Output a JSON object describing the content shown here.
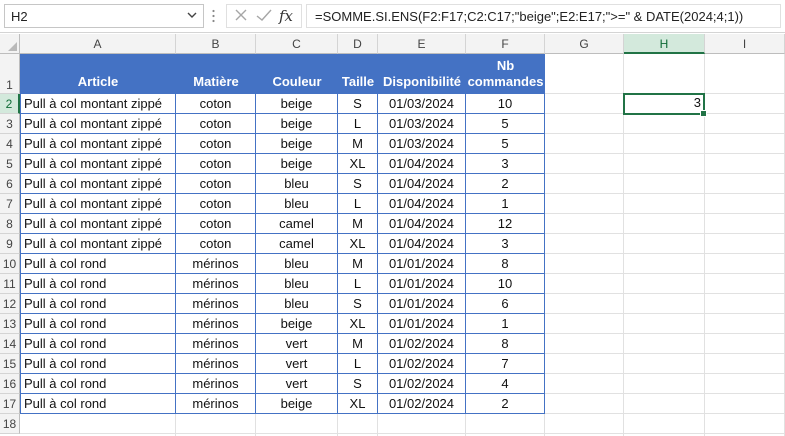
{
  "formula_bar": {
    "name_box": "H2",
    "formula": "=SOMME.SI.ENS(F2:F17;C2:C17;\"beige\";E2:E17;\">=\" & DATE(2024;4;1))",
    "fx_label": "fx"
  },
  "columns": [
    "A",
    "B",
    "C",
    "D",
    "E",
    "F",
    "G",
    "H",
    "I"
  ],
  "rows": [
    "1",
    "2",
    "3",
    "4",
    "5",
    "6",
    "7",
    "8",
    "9",
    "10",
    "11",
    "12",
    "13",
    "14",
    "15",
    "16",
    "17",
    "18"
  ],
  "headers": {
    "article": "Article",
    "matiere": "Matière",
    "couleur": "Couleur",
    "taille": "Taille",
    "disponibilite": "Disponibilité",
    "nb_commandes": "Nb commandes"
  },
  "data_rows": [
    {
      "article": "Pull à col montant zippé",
      "matiere": "coton",
      "couleur": "beige",
      "taille": "S",
      "dispo": "01/03/2024",
      "nb": "10"
    },
    {
      "article": "Pull à col montant zippé",
      "matiere": "coton",
      "couleur": "beige",
      "taille": "L",
      "dispo": "01/03/2024",
      "nb": "5"
    },
    {
      "article": "Pull à col montant zippé",
      "matiere": "coton",
      "couleur": "beige",
      "taille": "M",
      "dispo": "01/03/2024",
      "nb": "5"
    },
    {
      "article": "Pull à col montant zippé",
      "matiere": "coton",
      "couleur": "beige",
      "taille": "XL",
      "dispo": "01/04/2024",
      "nb": "3"
    },
    {
      "article": "Pull à col montant zippé",
      "matiere": "coton",
      "couleur": "bleu",
      "taille": "S",
      "dispo": "01/04/2024",
      "nb": "2"
    },
    {
      "article": "Pull à col montant zippé",
      "matiere": "coton",
      "couleur": "bleu",
      "taille": "L",
      "dispo": "01/04/2024",
      "nb": "1"
    },
    {
      "article": "Pull à col montant zippé",
      "matiere": "coton",
      "couleur": "camel",
      "taille": "M",
      "dispo": "01/04/2024",
      "nb": "12"
    },
    {
      "article": "Pull à col montant zippé",
      "matiere": "coton",
      "couleur": "camel",
      "taille": "XL",
      "dispo": "01/04/2024",
      "nb": "3"
    },
    {
      "article": "Pull à col rond",
      "matiere": "mérinos",
      "couleur": "bleu",
      "taille": "M",
      "dispo": "01/01/2024",
      "nb": "8"
    },
    {
      "article": "Pull à col rond",
      "matiere": "mérinos",
      "couleur": "bleu",
      "taille": "L",
      "dispo": "01/01/2024",
      "nb": "10"
    },
    {
      "article": "Pull à col rond",
      "matiere": "mérinos",
      "couleur": "bleu",
      "taille": "S",
      "dispo": "01/01/2024",
      "nb": "6"
    },
    {
      "article": "Pull à col rond",
      "matiere": "mérinos",
      "couleur": "beige",
      "taille": "XL",
      "dispo": "01/01/2024",
      "nb": "1"
    },
    {
      "article": "Pull à col rond",
      "matiere": "mérinos",
      "couleur": "vert",
      "taille": "M",
      "dispo": "01/02/2024",
      "nb": "8"
    },
    {
      "article": "Pull à col rond",
      "matiere": "mérinos",
      "couleur": "vert",
      "taille": "L",
      "dispo": "01/02/2024",
      "nb": "7"
    },
    {
      "article": "Pull à col rond",
      "matiere": "mérinos",
      "couleur": "vert",
      "taille": "S",
      "dispo": "01/02/2024",
      "nb": "4"
    },
    {
      "article": "Pull à col rond",
      "matiere": "mérinos",
      "couleur": "beige",
      "taille": "XL",
      "dispo": "01/02/2024",
      "nb": "2"
    }
  ],
  "result_cell": {
    "ref": "H2",
    "value": "3"
  },
  "colors": {
    "header_fill": "#4472c4",
    "selection": "#217346"
  }
}
